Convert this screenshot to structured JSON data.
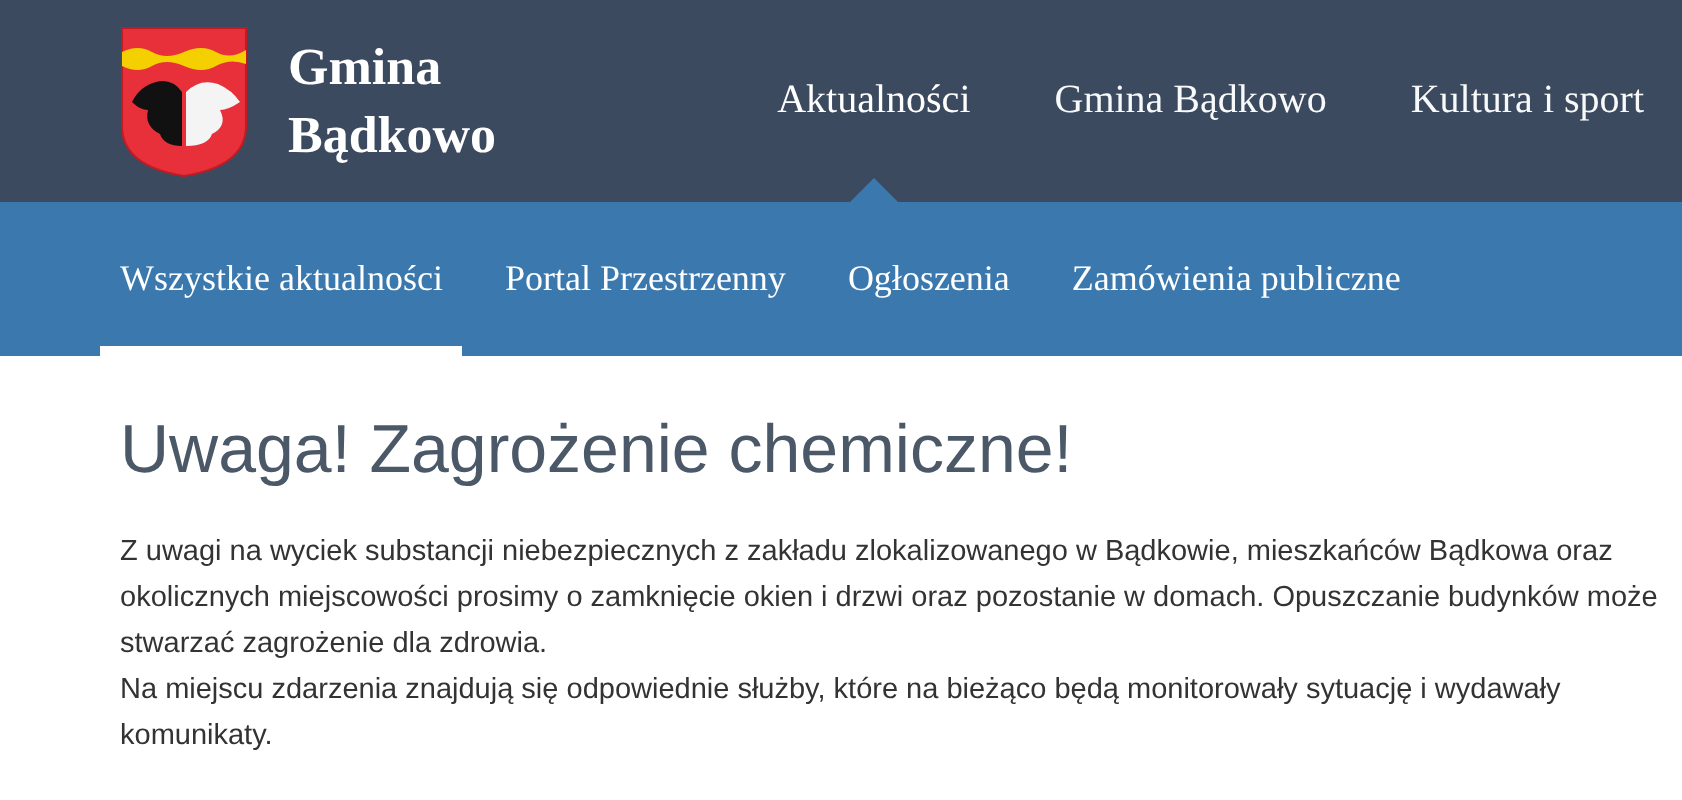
{
  "site": {
    "title_line_1": "Gmina",
    "title_line_2": "Bądkowo"
  },
  "main_nav": [
    {
      "label": "Aktualności",
      "selected": true
    },
    {
      "label": "Gmina Bądkowo",
      "selected": false
    },
    {
      "label": "Kultura i sport",
      "selected": false
    }
  ],
  "sub_nav": [
    {
      "label": "Wszystkie aktualności",
      "selected": true
    },
    {
      "label": "Portal Przestrzenny",
      "selected": false
    },
    {
      "label": "Ogłoszenia",
      "selected": false
    },
    {
      "label": "Zamówienia publiczne",
      "selected": false
    }
  ],
  "article": {
    "title": "Uwaga! Zagrożenie chemiczne!",
    "paragraphs": [
      "Z uwagi na wyciek substancji niebezpiecznych z zakładu zlokalizowanego w Bądkowie, mieszkańców Bądkowa oraz okolicznych miejscowości prosimy o zamknięcie okien i drzwi oraz pozostanie w domach. Opuszczanie budynków może stwarzać zagrożenie dla zdrowia.",
      "Na miejscu zdarzenia znajdują się odpowiednie służby, które na bieżąco będą monitorowały sytuację i wydawały komunikaty."
    ]
  }
}
